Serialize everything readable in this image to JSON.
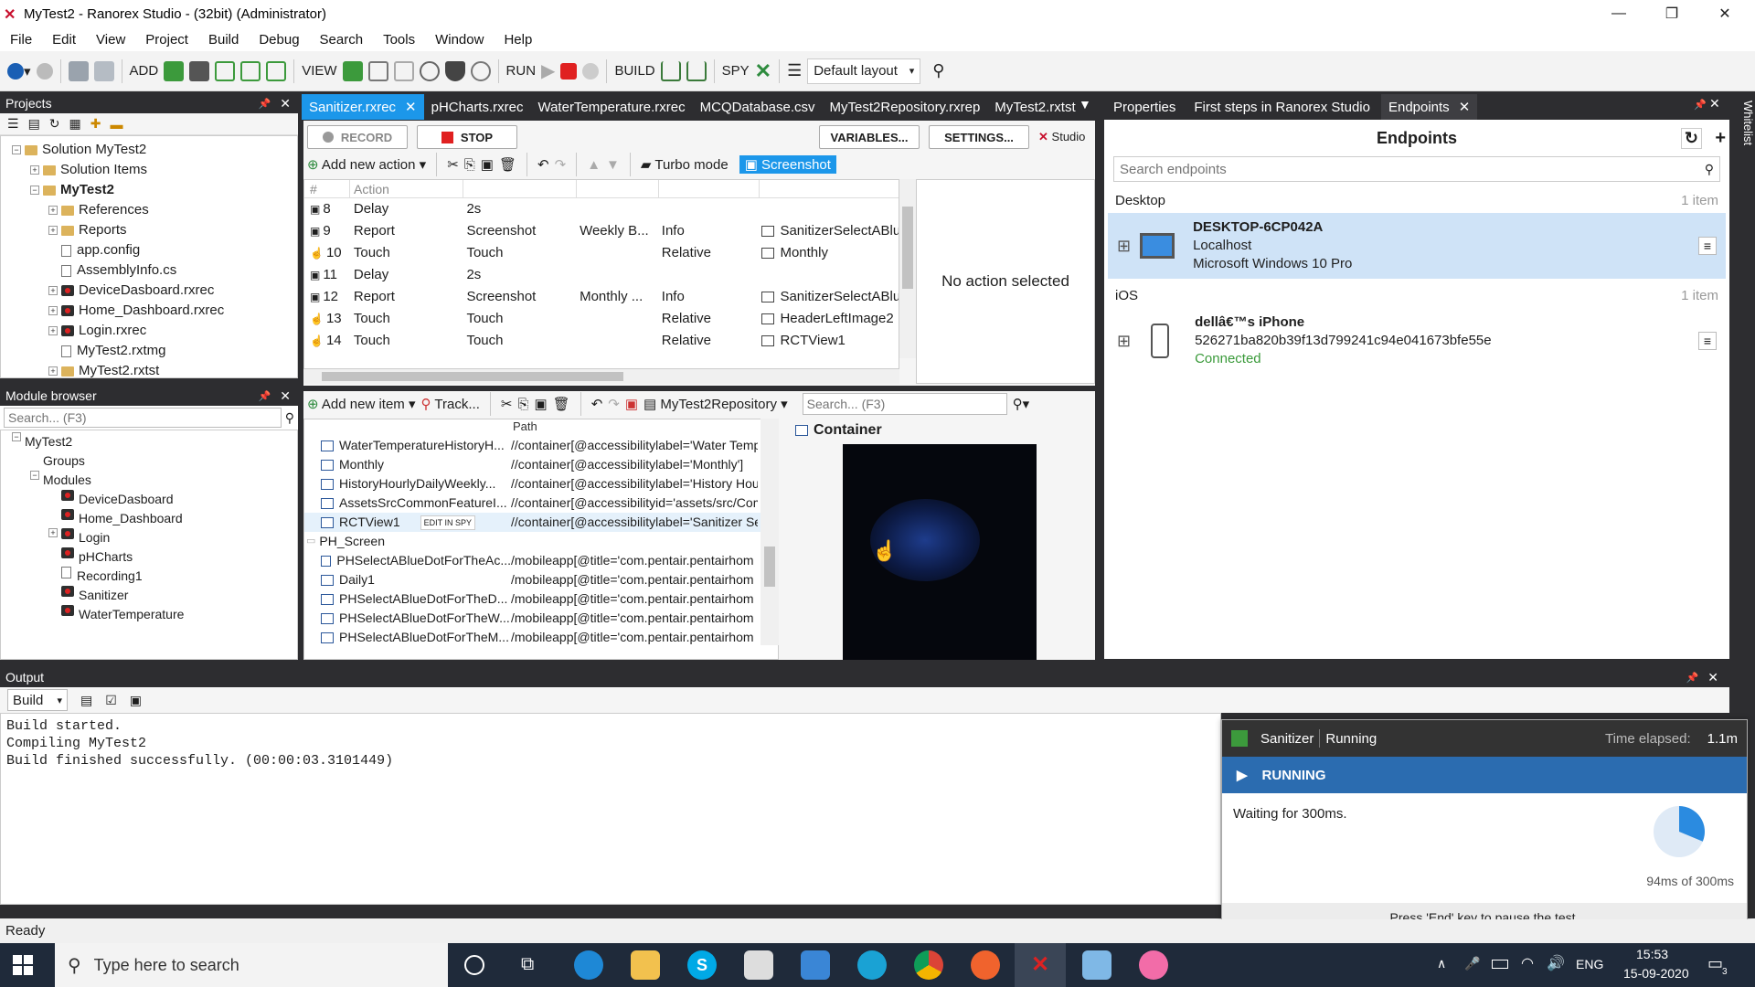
{
  "window": {
    "title": "MyTest2 - Ranorex Studio - (32bit) (Administrator)"
  },
  "menu": [
    "File",
    "Edit",
    "View",
    "Project",
    "Build",
    "Debug",
    "Search",
    "Tools",
    "Window",
    "Help"
  ],
  "toolbar": {
    "add": "ADD",
    "view": "VIEW",
    "run": "RUN",
    "build": "BUILD",
    "spy": "SPY",
    "layout": "Default layout"
  },
  "projects": {
    "title": "Projects",
    "items": [
      {
        "label": "Solution MyTest2",
        "indent": 0,
        "kind": "solution"
      },
      {
        "label": "Solution Items",
        "indent": 1,
        "kind": "folder"
      },
      {
        "label": "MyTest2",
        "indent": 1,
        "kind": "project"
      },
      {
        "label": "References",
        "indent": 2,
        "kind": "folder"
      },
      {
        "label": "Reports",
        "indent": 2,
        "kind": "folder"
      },
      {
        "label": "app.config",
        "indent": 2,
        "kind": "doc"
      },
      {
        "label": "AssemblyInfo.cs",
        "indent": 2,
        "kind": "doc"
      },
      {
        "label": "DeviceDasboard.rxrec",
        "indent": 2,
        "kind": "rx"
      },
      {
        "label": "Home_Dashboard.rxrec",
        "indent": 2,
        "kind": "rx"
      },
      {
        "label": "Login.rxrec",
        "indent": 2,
        "kind": "rx"
      },
      {
        "label": "MyTest2.rxtmg",
        "indent": 2,
        "kind": "doc"
      },
      {
        "label": "MyTest2.rxtst",
        "indent": 2,
        "kind": "folder"
      }
    ]
  },
  "module_browser": {
    "title": "Module browser",
    "search_placeholder": "Search... (F3)",
    "items": [
      {
        "label": "MyTest2",
        "indent": 0
      },
      {
        "label": "Groups",
        "indent": 1
      },
      {
        "label": "Modules",
        "indent": 1
      },
      {
        "label": "DeviceDasboard",
        "indent": 2
      },
      {
        "label": "Home_Dashboard",
        "indent": 2
      },
      {
        "label": "Login",
        "indent": 2
      },
      {
        "label": "pHCharts",
        "indent": 2
      },
      {
        "label": "Recording1",
        "indent": 2
      },
      {
        "label": "Sanitizer",
        "indent": 2
      },
      {
        "label": "WaterTemperature",
        "indent": 2
      }
    ]
  },
  "editor_tabs": [
    "Sanitizer.rxrec",
    "pHCharts.rxrec",
    "WaterTemperature.rxrec",
    "MCQDatabase.csv",
    "MyTest2Repository.rxrep",
    "MyTest2.rxtst"
  ],
  "recorder": {
    "record": "RECORD",
    "stop": "STOP",
    "variables": "VARIABLES...",
    "settings": "SETTINGS...",
    "studio": "Studio",
    "add_action": "Add new action",
    "turbo": "Turbo mode",
    "screenshot": "Screenshot",
    "columns": [
      "#",
      "Action",
      "",
      "",
      ""
    ],
    "rows": [
      {
        "n": "8",
        "action": "Delay",
        "c2": "2s",
        "c3": "",
        "c4": "",
        "c5": ""
      },
      {
        "n": "9",
        "action": "Report",
        "c2": "Screenshot",
        "c3": "Weekly B...",
        "c4": "Info",
        "c5": "SanitizerSelectABlu"
      },
      {
        "n": "10",
        "action": "Touch",
        "c2": "Touch",
        "c3": "",
        "c4": "Relative",
        "c5": "Monthly"
      },
      {
        "n": "11",
        "action": "Delay",
        "c2": "2s",
        "c3": "",
        "c4": "",
        "c5": ""
      },
      {
        "n": "12",
        "action": "Report",
        "c2": "Screenshot",
        "c3": "Monthly ...",
        "c4": "Info",
        "c5": "SanitizerSelectABlu"
      },
      {
        "n": "13",
        "action": "Touch",
        "c2": "Touch",
        "c3": "",
        "c4": "Relative",
        "c5": "HeaderLeftImage2"
      },
      {
        "n": "14",
        "action": "Touch",
        "c2": "Touch",
        "c3": "",
        "c4": "Relative",
        "c5": "RCTView1"
      }
    ],
    "no_action": "No action selected"
  },
  "repository": {
    "add_item": "Add new item",
    "track": "Track...",
    "repo_name": "MyTest2Repository",
    "search_placeholder": "Search... (F3)",
    "path_header": "Path",
    "edit_in_spy": "EDIT IN SPY",
    "container_label": "Container",
    "items": [
      {
        "name": "WaterTemperatureHistoryH...",
        "path": "//container[@accessibilitylabel='Water Temp"
      },
      {
        "name": "Monthly",
        "path": "//container[@accessibilitylabel='Monthly']"
      },
      {
        "name": "HistoryHourlyDailyWeekly...",
        "path": "//container[@accessibilitylabel='History Hou"
      },
      {
        "name": "AssetsSrcCommonFeatureI...",
        "path": "//container[@accessibilityid='assets/src/Com"
      },
      {
        "name": "RCTView1",
        "path": "//container[@accessibilitylabel='Sanitizer Sel"
      },
      {
        "name": "PH_Screen",
        "path": "",
        "group": true
      },
      {
        "name": "PHSelectABlueDotForTheAc...",
        "path": "/mobileapp[@title='com.pentair.pentairhom"
      },
      {
        "name": "Daily1",
        "path": "/mobileapp[@title='com.pentair.pentairhom"
      },
      {
        "name": "PHSelectABlueDotForTheD...",
        "path": "/mobileapp[@title='com.pentair.pentairhom"
      },
      {
        "name": "PHSelectABlueDotForTheW...",
        "path": "/mobileapp[@title='com.pentair.pentairhom"
      },
      {
        "name": "PHSelectABlueDotForTheM...",
        "path": "/mobileapp[@title='com.pentair.pentairhom"
      }
    ]
  },
  "right_tabs": [
    "Properties",
    "First steps in Ranorex Studio",
    "Endpoints"
  ],
  "endpoints": {
    "title": "Endpoints",
    "search_placeholder": "Search endpoints",
    "desktop_header": "Desktop",
    "desktop_count": "1 item",
    "desktop": {
      "name": "DESKTOP-6CP042A",
      "line2": "Localhost",
      "line3": "Microsoft Windows 10 Pro"
    },
    "ios_header": "iOS",
    "ios_count": "1 item",
    "ios": {
      "name": "dellâ€™s iPhone",
      "line2": "526271ba820b39f13d799241c94e041673bfe55e",
      "line3": "Connected"
    }
  },
  "whitelist": "Whitelist",
  "output": {
    "title": "Output",
    "filter": "Build",
    "lines": [
      "Build started.",
      "Compiling MyTest2",
      "Build finished successfully. (00:00:03.3101449)"
    ]
  },
  "run_popup": {
    "test": "Sanitizer",
    "status": "Running",
    "elapsed_label": "Time elapsed:",
    "elapsed": "1.1m",
    "banner": "RUNNING",
    "message": "Waiting for 300ms.",
    "progress_text": "94ms of 300ms",
    "progress": 0.313,
    "footer": "Press 'End' key to pause the test."
  },
  "statusbar": {
    "text": "Ready"
  },
  "taskbar": {
    "search_placeholder": "Type here to search",
    "lang": "ENG",
    "time": "15:53",
    "date": "15-09-2020",
    "notif": "3"
  },
  "colors": {
    "accent": "#1c97ea",
    "running": "#2b6cb0",
    "connected": "#3a9a3a",
    "stop": "#e02020"
  }
}
